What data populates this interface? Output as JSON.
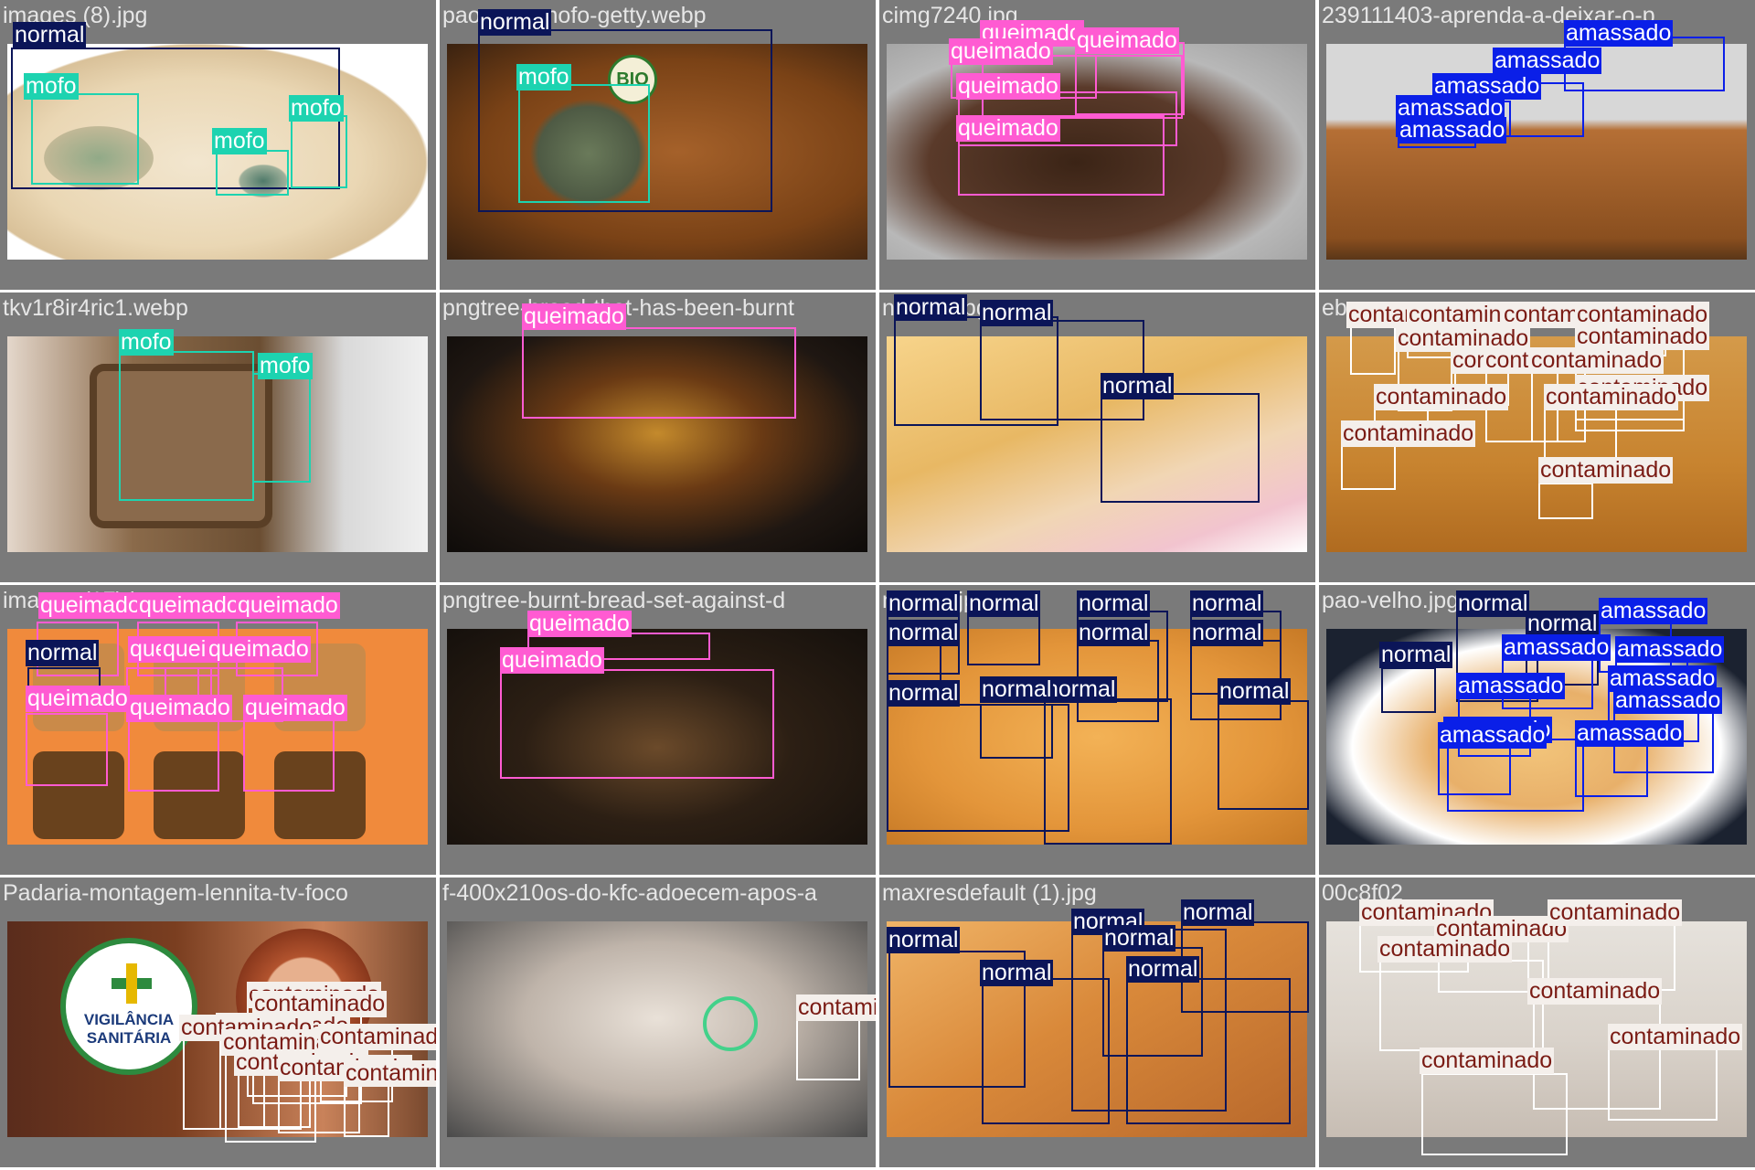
{
  "colors": {
    "normal": "#0b1558",
    "mofo": "#1dd3b0",
    "queimado": "#ff5bd2",
    "amassado": "#0a1fe8",
    "contaminado": "#f4efeb",
    "contaminado_text": "#7a1b14",
    "tile_bg": "#7a7a7a",
    "title_text": "#e6e6e6"
  },
  "tiles": [
    {
      "title": "images (8).jpg",
      "bg": "bg-slice",
      "labels": [
        {
          "cls": "normal",
          "text": "normal"
        },
        {
          "cls": "mofo",
          "text": "mofo"
        },
        {
          "cls": "mofo",
          "text": "mofo"
        },
        {
          "cls": "mofo",
          "text": "mofo"
        }
      ]
    },
    {
      "title": "pao-com-mofo-getty.webp",
      "bg": "bg-wholemeal",
      "labels": [
        {
          "cls": "normal",
          "text": "normal"
        },
        {
          "cls": "mofo",
          "text": "mofo"
        }
      ]
    },
    {
      "title": "cimg7240.jpg",
      "bg": "bg-burnt-plate",
      "labels": [
        {
          "cls": "queimado",
          "text": "queimado"
        },
        {
          "cls": "queimado",
          "text": "queimado"
        },
        {
          "cls": "queimado",
          "text": "queimado"
        },
        {
          "cls": "queimado",
          "text": "queimado"
        },
        {
          "cls": "queimado",
          "text": "queimado"
        }
      ]
    },
    {
      "title": "239111403-aprenda-a-deixar-o-p",
      "bg": "bg-basket",
      "labels": [
        {
          "cls": "amassado",
          "text": "amassado"
        },
        {
          "cls": "amassado",
          "text": "amassado"
        },
        {
          "cls": "amassado",
          "text": "amassado"
        },
        {
          "cls": "amassado",
          "text": "amassado"
        },
        {
          "cls": "amassado",
          "text": "amassado"
        }
      ]
    },
    {
      "title": "tkv1r8ir4ric1.webp",
      "bg": "bg-hand",
      "labels": [
        {
          "cls": "mofo",
          "text": "mofo"
        },
        {
          "cls": "mofo",
          "text": "mofo"
        }
      ]
    },
    {
      "title": "pngtree-bread-that-has-been-burnt",
      "bg": "bg-burnt-dark",
      "labels": [
        {
          "cls": "queimado",
          "text": "queimado"
        }
      ]
    },
    {
      "title": "normal.jpg",
      "bg": "bg-rolls-cloth",
      "labels": [
        {
          "cls": "normal",
          "text": "normal"
        },
        {
          "cls": "normal",
          "text": "normal"
        },
        {
          "cls": "normal",
          "text": "normal"
        }
      ]
    },
    {
      "title": "eb",
      "bg": "bg-flies",
      "labels": [
        {
          "cls": "contaminado",
          "text": "contaminado"
        },
        {
          "cls": "contaminado",
          "text": "contaminado"
        },
        {
          "cls": "contaminado",
          "text": "contaminado"
        },
        {
          "cls": "contaminado",
          "text": "contaminado"
        },
        {
          "cls": "contaminado",
          "text": "contaminado"
        },
        {
          "cls": "contaminado",
          "text": "contaminado"
        },
        {
          "cls": "contaminado",
          "text": "contaminado"
        },
        {
          "cls": "contaminado",
          "text": "contaminado"
        },
        {
          "cls": "contaminado",
          "text": "contaminado"
        },
        {
          "cls": "contaminado",
          "text": "contaminado"
        },
        {
          "cls": "contaminado",
          "text": "contaminado"
        },
        {
          "cls": "contaminado",
          "text": "contaminado"
        },
        {
          "cls": "contaminado",
          "text": "contaminado"
        },
        {
          "cls": "contaminado",
          "text": "contaminado"
        }
      ]
    },
    {
      "title": "images (17).jpg",
      "bg": "bg-toast",
      "labels": [
        {
          "cls": "queimado",
          "text": "queimado"
        },
        {
          "cls": "queimado",
          "text": "queimado"
        },
        {
          "cls": "queimado",
          "text": "queimado"
        },
        {
          "cls": "normal",
          "text": "normal"
        },
        {
          "cls": "queimado",
          "text": "queimado"
        },
        {
          "cls": "queimado",
          "text": "queimado"
        },
        {
          "cls": "queimado",
          "text": "queimado"
        },
        {
          "cls": "queimado",
          "text": "queimado"
        },
        {
          "cls": "queimado",
          "text": "queimado"
        },
        {
          "cls": "queimado",
          "text": "queimado"
        }
      ]
    },
    {
      "title": "pngtree-burnt-bread-set-against-d",
      "bg": "bg-burnt-loaf",
      "labels": [
        {
          "cls": "queimado",
          "text": "queimado"
        },
        {
          "cls": "queimado",
          "text": "queimado"
        }
      ]
    },
    {
      "title": "normal.jpg",
      "bg": "bg-buns",
      "labels": [
        {
          "cls": "normal",
          "text": "normal"
        },
        {
          "cls": "normal",
          "text": "normal"
        },
        {
          "cls": "normal",
          "text": "normal"
        },
        {
          "cls": "normal",
          "text": "normal"
        },
        {
          "cls": "normal",
          "text": "normal"
        },
        {
          "cls": "normal",
          "text": "normal"
        },
        {
          "cls": "normal",
          "text": "normal"
        },
        {
          "cls": "normal",
          "text": "normal"
        },
        {
          "cls": "normal",
          "text": "normal"
        },
        {
          "cls": "normal",
          "text": "normal"
        },
        {
          "cls": "normal",
          "text": "normal"
        }
      ]
    },
    {
      "title": "pao-velho.jpg",
      "bg": "bg-plate",
      "labels": [
        {
          "cls": "normal",
          "text": "normal"
        },
        {
          "cls": "normal",
          "text": "normal"
        },
        {
          "cls": "amassado",
          "text": "amassado"
        },
        {
          "cls": "normal",
          "text": "normal"
        },
        {
          "cls": "amassado",
          "text": "amassado"
        },
        {
          "cls": "amassado",
          "text": "amassado"
        },
        {
          "cls": "amassado",
          "text": "amassado"
        },
        {
          "cls": "amassado",
          "text": "amassado"
        },
        {
          "cls": "amassado",
          "text": "amassado"
        },
        {
          "cls": "amassado",
          "text": "amassado"
        },
        {
          "cls": "amassado",
          "text": "amassado"
        },
        {
          "cls": "amassado",
          "text": "amassado"
        }
      ]
    },
    {
      "title": "Padaria-montagem-lennita-tv-foco",
      "bg": "bg-mall",
      "labels": [
        {
          "cls": "contaminado",
          "text": "contaminado"
        },
        {
          "cls": "contaminado",
          "text": "contaminado"
        },
        {
          "cls": "contaminado",
          "text": "contaminado"
        },
        {
          "cls": "contaminado",
          "text": "contaminado"
        },
        {
          "cls": "contaminado",
          "text": "contaminado"
        },
        {
          "cls": "contaminado",
          "text": "contaminado"
        },
        {
          "cls": "contaminado",
          "text": "contaminado"
        },
        {
          "cls": "contaminado",
          "text": "contaminado"
        },
        {
          "cls": "contaminado",
          "text": "contaminado"
        }
      ]
    },
    {
      "title": "f-400x210os-do-kfc-adoecem-apos-a",
      "bg": "bg-bag",
      "labels": [
        {
          "cls": "contaminado",
          "text": "contaminado"
        }
      ]
    },
    {
      "title": "maxresdefault (1).jpg",
      "bg": "bg-french",
      "labels": [
        {
          "cls": "normal",
          "text": "normal"
        },
        {
          "cls": "normal",
          "text": "normal"
        },
        {
          "cls": "normal",
          "text": "normal"
        },
        {
          "cls": "normal",
          "text": "normal"
        },
        {
          "cls": "normal",
          "text": "normal"
        },
        {
          "cls": "normal",
          "text": "normal"
        }
      ]
    },
    {
      "title": "00c8f02",
      "bg": "bg-mosquito",
      "labels": [
        {
          "cls": "contaminado",
          "text": "contaminado"
        },
        {
          "cls": "contaminado",
          "text": "contaminado"
        },
        {
          "cls": "contaminado",
          "text": "contaminado"
        },
        {
          "cls": "contaminado",
          "text": "contaminado"
        },
        {
          "cls": "contaminado",
          "text": "contaminado"
        },
        {
          "cls": "contaminado",
          "text": "contaminado"
        },
        {
          "cls": "contaminado",
          "text": "contaminado"
        }
      ]
    }
  ],
  "logo": {
    "line1": "VIGILÂNCIA",
    "line2": "SANITÁRIA"
  },
  "stamp": {
    "text": "BIO"
  }
}
